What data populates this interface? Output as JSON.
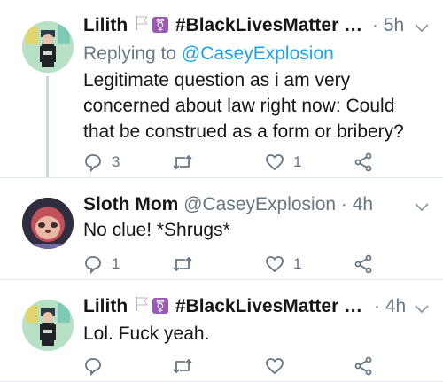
{
  "tweets": [
    {
      "name": "Lilith",
      "hashtag": "#BlackLivesMatter …",
      "time": "· 5h",
      "reply_prefix": "Replying to ",
      "reply_handle": "@CaseyExplosion",
      "text": "Legitimate question as i am very concerned about law right now: Could that be construed as a form or bribery?",
      "replies": "3",
      "retweets": "",
      "likes": "1"
    },
    {
      "name": "Sloth Mom",
      "handle": "@CaseyExplosion",
      "time": "· 4h",
      "text": "No clue! *Shrugs*",
      "replies": "1",
      "retweets": "",
      "likes": "1"
    },
    {
      "name": "Lilith",
      "hashtag": "#BlackLivesMatter …",
      "time": "· 4h",
      "text": "Lol. Fuck yeah.",
      "replies": "",
      "retweets": "",
      "likes": ""
    }
  ],
  "icons": [
    "white-flag-icon",
    "transgender-symbol-icon",
    "chevron-down-icon",
    "reply-icon",
    "retweet-icon",
    "like-icon",
    "share-icon"
  ],
  "colors": {
    "link": "#1da1f2",
    "meta": "#657786",
    "text": "#14171a",
    "divider": "#e1e8ed",
    "thread_line": "#ccd6dd"
  }
}
